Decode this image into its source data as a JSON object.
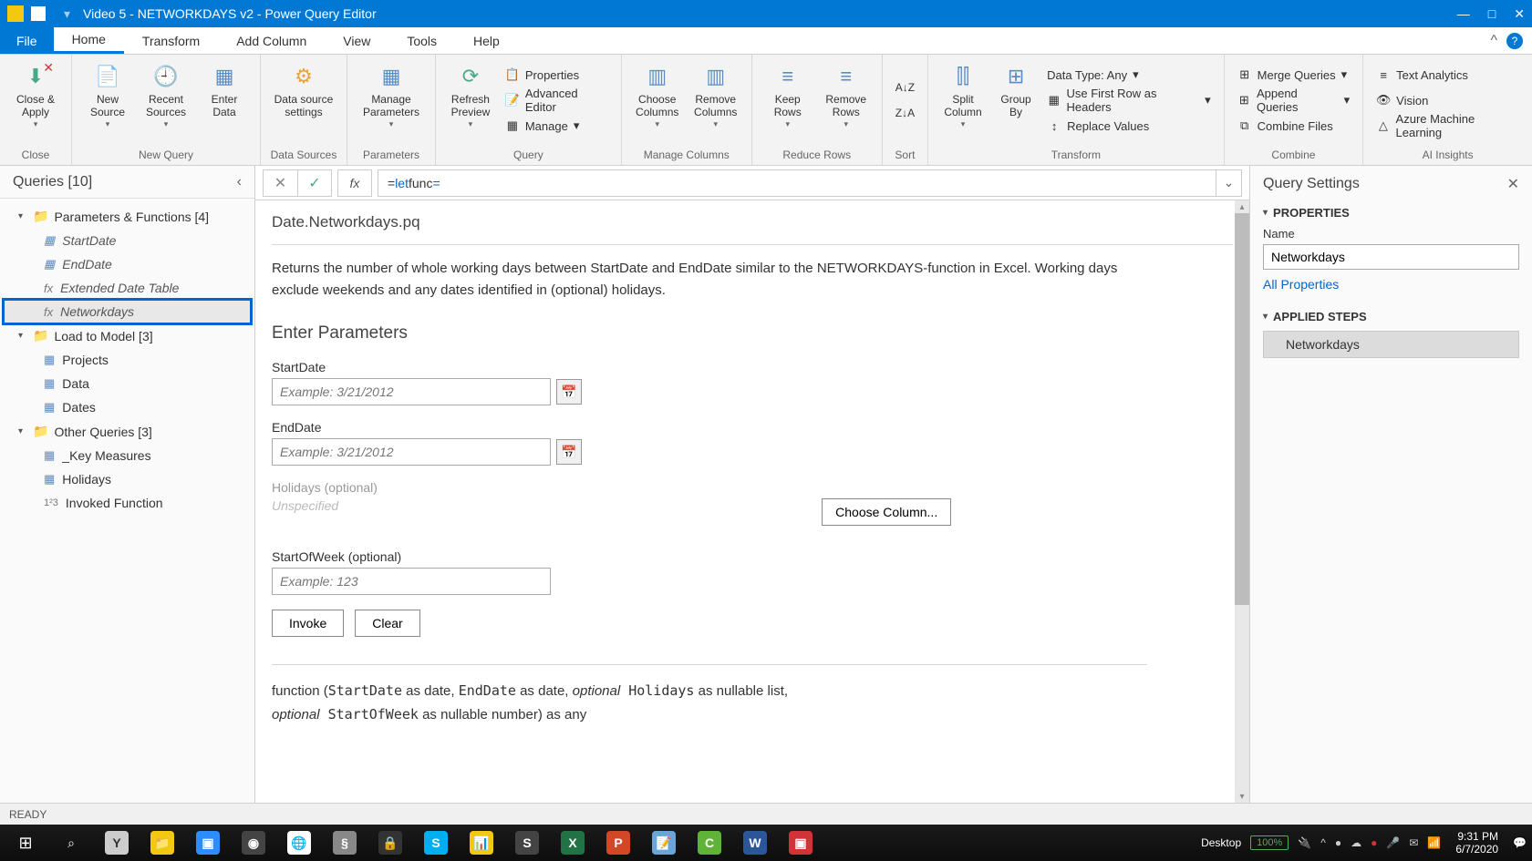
{
  "title": "Video 5 - NETWORKDAYS v2 - Power Query Editor",
  "menu": {
    "file": "File",
    "home": "Home",
    "transform": "Transform",
    "add_column": "Add Column",
    "view": "View",
    "tools": "Tools",
    "help": "Help"
  },
  "ribbon": {
    "close": {
      "label": "Close &\nApply",
      "group": "Close"
    },
    "new_query": {
      "new_source": "New\nSource",
      "recent": "Recent\nSources",
      "enter": "Enter\nData",
      "group": "New Query"
    },
    "data_sources": {
      "settings": "Data source\nsettings",
      "group": "Data Sources"
    },
    "parameters": {
      "manage": "Manage\nParameters",
      "group": "Parameters"
    },
    "query": {
      "refresh": "Refresh\nPreview",
      "props": "Properties",
      "adv": "Advanced Editor",
      "manage": "Manage",
      "group": "Query"
    },
    "manage_cols": {
      "choose": "Choose\nColumns",
      "remove": "Remove\nColumns",
      "group": "Manage Columns"
    },
    "reduce": {
      "keep": "Keep\nRows",
      "remove": "Remove\nRows",
      "group": "Reduce Rows"
    },
    "sort": {
      "group": "Sort"
    },
    "transform": {
      "split": "Split\nColumn",
      "group_by": "Group\nBy",
      "dtype": "Data Type: Any",
      "first_row": "Use First Row as Headers",
      "replace": "Replace Values",
      "group": "Transform"
    },
    "combine": {
      "merge": "Merge Queries",
      "append": "Append Queries",
      "files": "Combine Files",
      "group": "Combine"
    },
    "ai": {
      "text": "Text Analytics",
      "vision": "Vision",
      "ml": "Azure Machine Learning",
      "group": "AI Insights"
    }
  },
  "queries": {
    "header": "Queries [10]",
    "groups": [
      {
        "name": "Parameters & Functions [4]",
        "items": [
          {
            "label": "StartDate",
            "icon": "tbl",
            "italic": true
          },
          {
            "label": "EndDate",
            "icon": "tbl",
            "italic": true
          },
          {
            "label": "Extended Date Table",
            "icon": "fx",
            "italic": true
          },
          {
            "label": "Networkdays",
            "icon": "fx",
            "italic": true,
            "selected": true
          }
        ]
      },
      {
        "name": "Load to Model [3]",
        "items": [
          {
            "label": "Projects",
            "icon": "tbl"
          },
          {
            "label": "Data",
            "icon": "tbl"
          },
          {
            "label": "Dates",
            "icon": "tbl"
          }
        ]
      },
      {
        "name": "Other Queries [3]",
        "items": [
          {
            "label": "_Key Measures",
            "icon": "tbl"
          },
          {
            "label": "Holidays",
            "icon": "tbl"
          },
          {
            "label": "Invoked Function",
            "icon": "123"
          }
        ]
      }
    ]
  },
  "formula": {
    "prefix": "= ",
    "kw1": "let",
    "mid": "  func  ",
    "kw2": "="
  },
  "func": {
    "title": "Date.Networkdays.pq",
    "desc": "Returns the number of whole working days between StartDate and EndDate similar to the NETWORKDAYS-function in Excel. Working days exclude weekends and any dates identified in (optional) holidays.",
    "enter": "Enter Parameters",
    "params": {
      "start": {
        "label": "StartDate",
        "placeholder": "Example: 3/21/2012"
      },
      "end": {
        "label": "EndDate",
        "placeholder": "Example: 3/21/2012"
      },
      "holidays": {
        "label": "Holidays (optional)",
        "unspecified": "Unspecified",
        "choose": "Choose Column..."
      },
      "sow": {
        "label": "StartOfWeek (optional)",
        "placeholder": "Example: 123"
      }
    },
    "invoke": "Invoke",
    "clear": "Clear",
    "sig1a": "function (",
    "sig1b": "StartDate",
    "sig1c": " as date, ",
    "sig1d": "EndDate",
    "sig1e": " as date, ",
    "sig1f": "optional",
    "sig1g": " Holidays",
    "sig1h": " as nullable list,",
    "sig2a": "optional",
    "sig2b": " StartOfWeek",
    "sig2c": " as nullable number) as any"
  },
  "settings": {
    "header": "Query Settings",
    "props": "PROPERTIES",
    "name_label": "Name",
    "name_value": "Networkdays",
    "all_props": "All Properties",
    "applied": "APPLIED STEPS",
    "step": "Networkdays"
  },
  "status": "READY",
  "taskbar": {
    "desktop": "Desktop",
    "battery": "100%",
    "time": "9:31 PM",
    "date": "6/7/2020"
  }
}
